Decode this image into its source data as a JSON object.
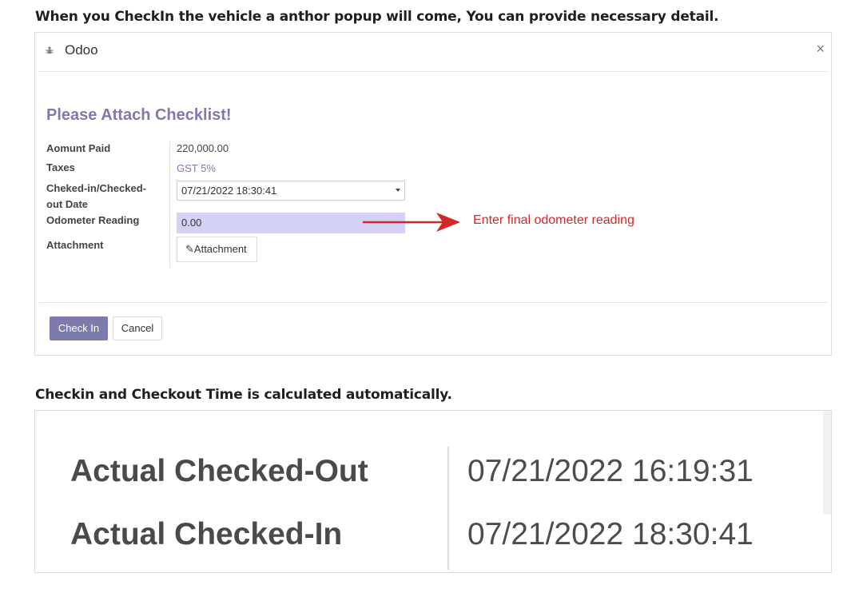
{
  "headings": {
    "intro": "When you CheckIn the vehicle a anthor popup will come, You can provide necessary detail.",
    "auto": "Checkin and Checkout Time is calculated automatically."
  },
  "modal": {
    "app_title": "Odoo",
    "close_symbol": "×",
    "checklist_title": "Please Attach Checklist!",
    "fields": {
      "amount_paid_label": "Aomunt Paid",
      "amount_paid_value": "220,000.00",
      "taxes_label": "Taxes",
      "taxes_value": "GST 5%",
      "checkin_date_label": "Cheked-in/Checked-out Date",
      "checkin_date_value": "07/21/2022 18:30:41",
      "odometer_label": "Odometer Reading",
      "odometer_value": "0.00",
      "attachment_label": "Attachment",
      "attachment_button": "Attachment"
    },
    "annotation": "Enter final odometer reading",
    "buttons": {
      "check_in": "Check In",
      "cancel": "Cancel"
    }
  },
  "times": {
    "checked_out_label": "Actual Checked-Out",
    "checked_out_value": "07/21/2022 16:19:31",
    "checked_in_label": "Actual Checked-In",
    "checked_in_value": "07/21/2022 18:30:41"
  },
  "colors": {
    "accent": "#7c7bad",
    "annotation": "#d42828",
    "odometer_bg": "#d3d1f4"
  },
  "icons": {
    "app": "bug-icon",
    "close": "close-icon",
    "attachment": "paperclip-icon"
  }
}
